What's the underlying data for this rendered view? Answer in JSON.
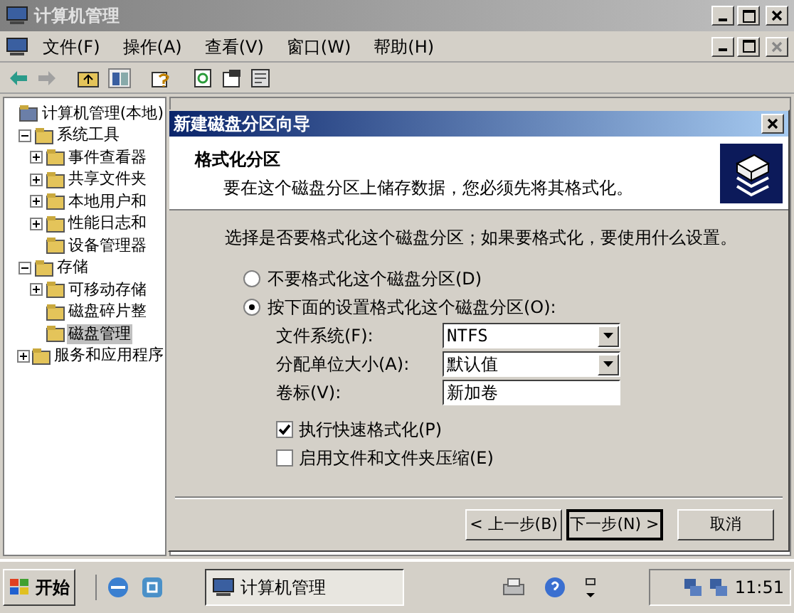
{
  "window": {
    "title": "计算机管理"
  },
  "menu": [
    "文件(F)",
    "操作(A)",
    "查看(V)",
    "窗口(W)",
    "帮助(H)"
  ],
  "tree": [
    {
      "label": "计算机管理(本地)",
      "selected": false,
      "children": [
        {
          "label": "系统工具",
          "expanded": true,
          "selected": false,
          "children": [
            {
              "label": "事件查看器",
              "expanded": false,
              "selected": false
            },
            {
              "label": "共享文件夹",
              "expanded": false,
              "selected": false
            },
            {
              "label": "本地用户和",
              "expanded": false,
              "selected": false
            },
            {
              "label": "性能日志和",
              "expanded": false,
              "selected": false
            },
            {
              "label": "设备管理器",
              "selected": false
            }
          ]
        },
        {
          "label": "存储",
          "expanded": true,
          "selected": false,
          "children": [
            {
              "label": "可移动存储",
              "expanded": false,
              "selected": false
            },
            {
              "label": "磁盘碎片整",
              "selected": false
            },
            {
              "label": "磁盘管理",
              "selected": true
            }
          ]
        },
        {
          "label": "服务和应用程序",
          "expanded": false,
          "selected": false
        }
      ]
    }
  ],
  "dialog": {
    "title": "新建磁盘分区向导",
    "heading": "格式化分区",
    "subheading": "要在这个磁盘分区上储存数据，您必须先将其格式化。",
    "prompt": "选择是否要格式化这个磁盘分区；如果要格式化，要使用什么设置。",
    "options": [
      {
        "label": "不要格式化这个磁盘分区(D)",
        "selected": false
      },
      {
        "label": "按下面的设置格式化这个磁盘分区(O):",
        "selected": true
      }
    ],
    "fields": [
      {
        "kind": "select",
        "label": "文件系统(F):",
        "value": "NTFS"
      },
      {
        "kind": "select",
        "label": "分配单位大小(A):",
        "value": "默认值"
      },
      {
        "kind": "text",
        "label": "卷标(V):",
        "value": "新加卷"
      }
    ],
    "checkboxes": [
      {
        "label": "执行快速格式化(P)",
        "checked": true
      },
      {
        "label": "启用文件和文件夹压缩(E)",
        "checked": false
      }
    ],
    "buttons": [
      {
        "label": "< 上一步(B)",
        "kind": "normal"
      },
      {
        "label": "下一步(N) >",
        "kind": "default"
      },
      {
        "label": "取消",
        "kind": "normal"
      }
    ]
  },
  "taskbar": {
    "start": "开始",
    "tasks": [
      {
        "label": "计算机管理",
        "selected": true
      }
    ],
    "clock": "11:51"
  }
}
